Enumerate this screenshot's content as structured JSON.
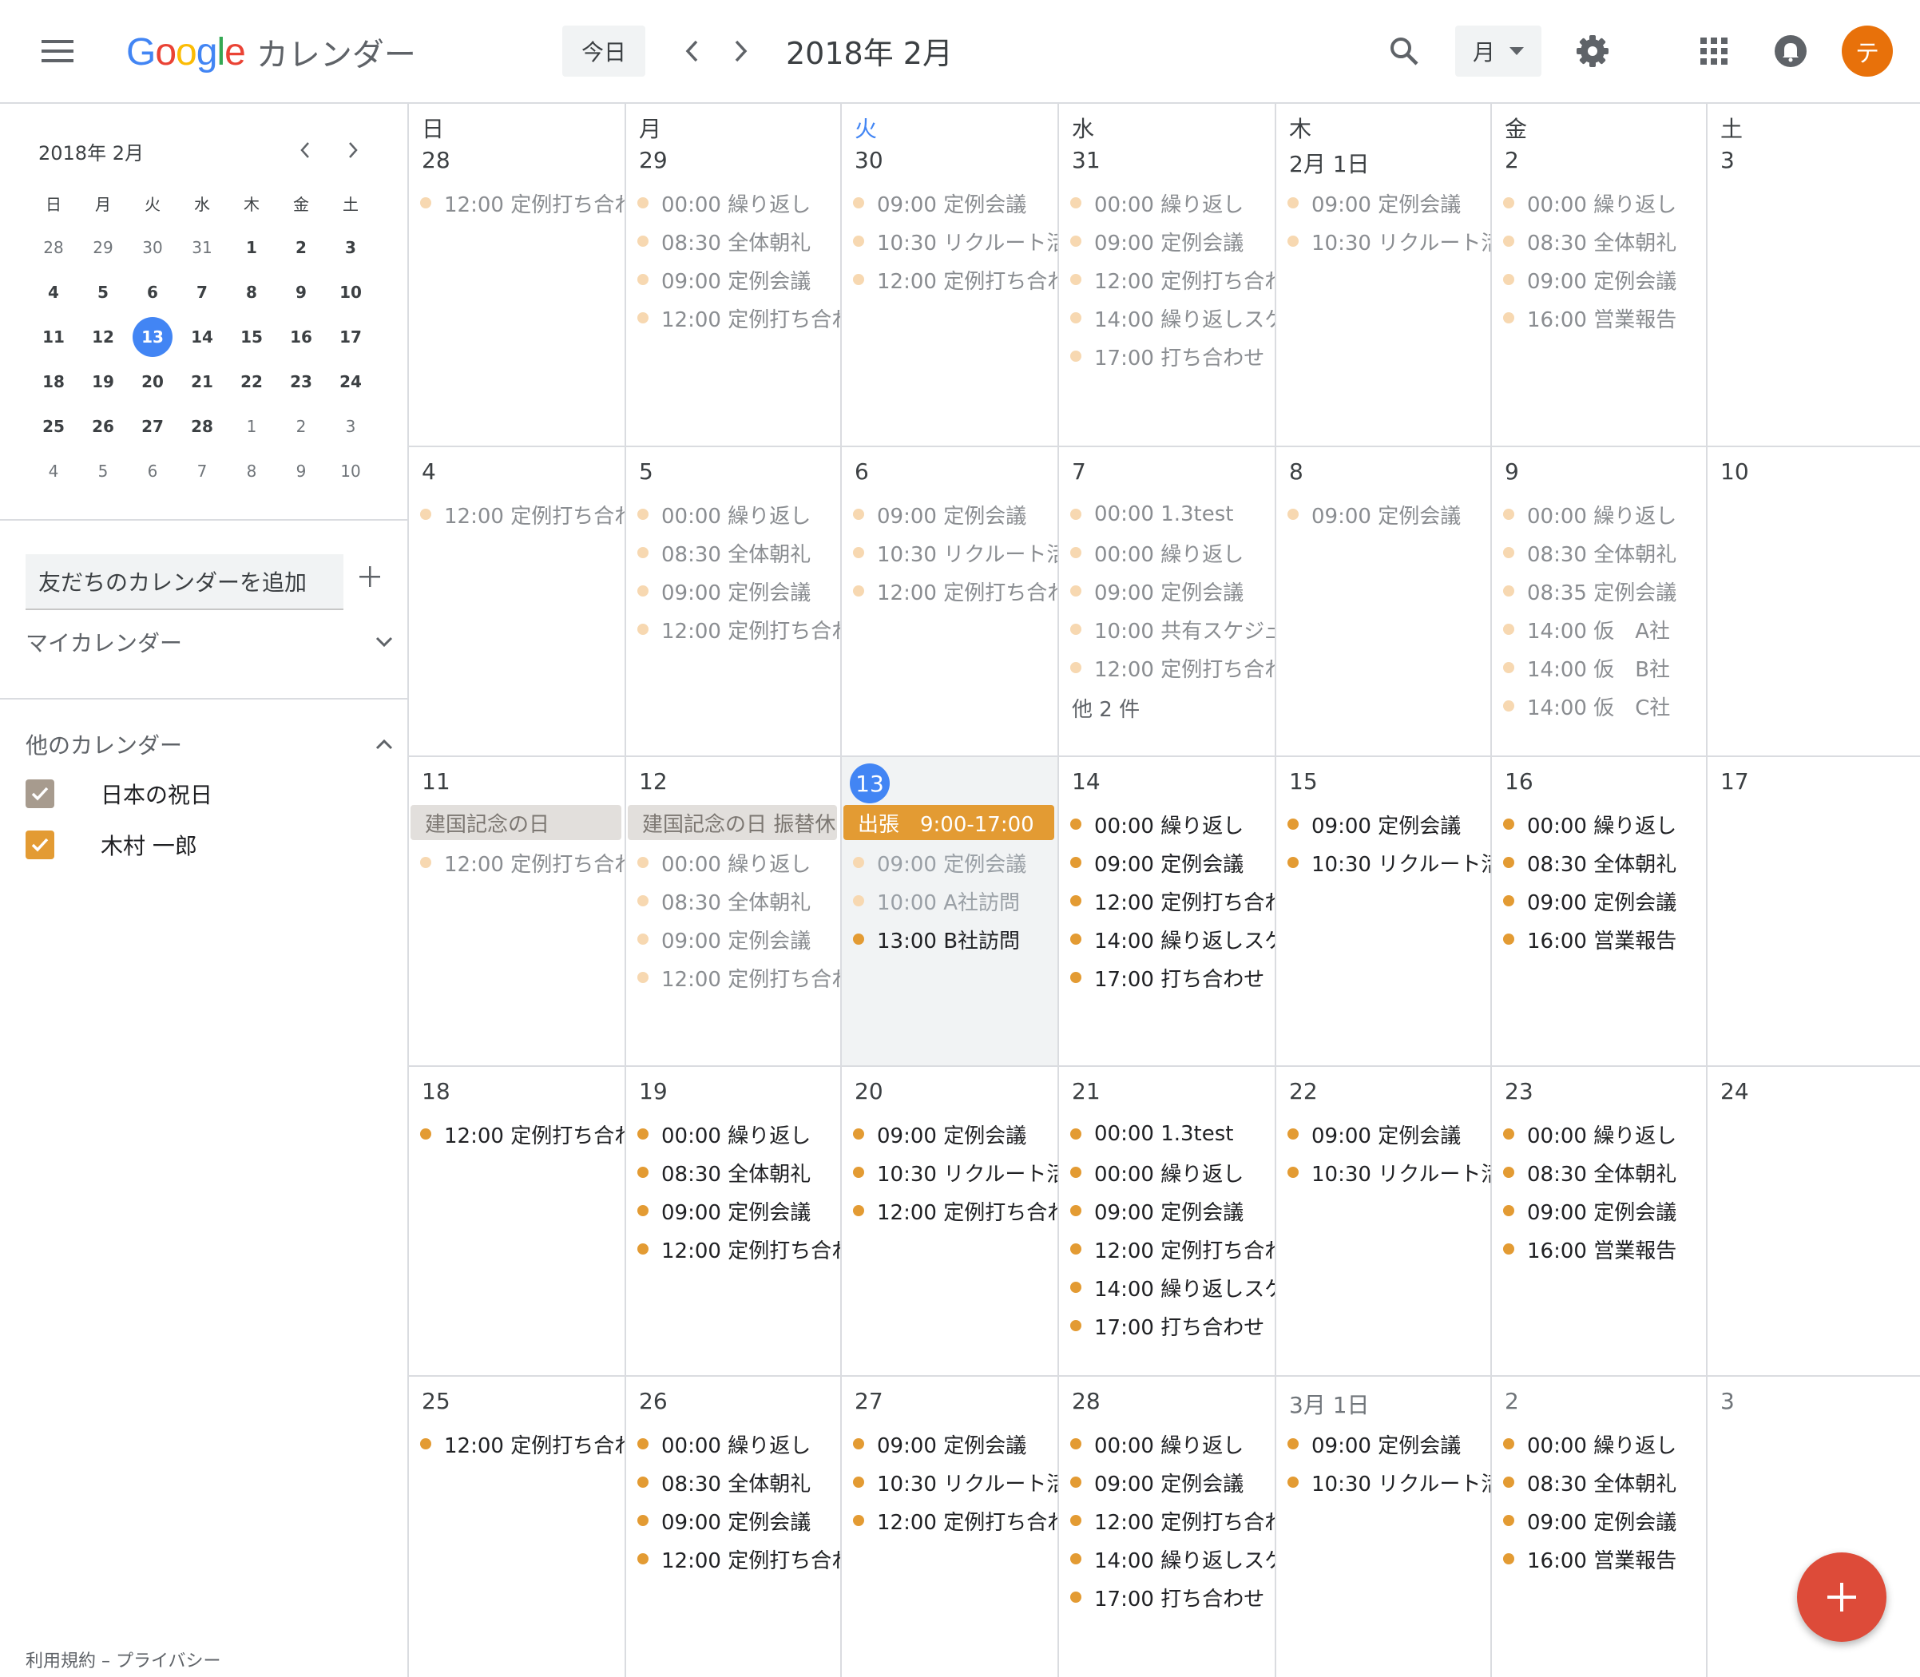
{
  "header": {
    "logo_text": "Google",
    "app_name": "カレンダー",
    "today_label": "今日",
    "current_period": "2018年 2月",
    "view_label": "月",
    "avatar_initial": "テ"
  },
  "mini_calendar": {
    "title": "2018年 2月",
    "weekday_headers": [
      "日",
      "月",
      "火",
      "水",
      "木",
      "金",
      "土"
    ],
    "weeks": [
      [
        "28",
        "29",
        "30",
        "31",
        "1",
        "2",
        "3"
      ],
      [
        "4",
        "5",
        "6",
        "7",
        "8",
        "9",
        "10"
      ],
      [
        "11",
        "12",
        "13",
        "14",
        "15",
        "16",
        "17"
      ],
      [
        "18",
        "19",
        "20",
        "21",
        "22",
        "23",
        "24"
      ],
      [
        "25",
        "26",
        "27",
        "28",
        "1",
        "2",
        "3"
      ],
      [
        "4",
        "5",
        "6",
        "7",
        "8",
        "9",
        "10"
      ]
    ],
    "today": "13"
  },
  "sidebar": {
    "add_friend_placeholder": "友だちのカレンダーを追加",
    "my_calendars_label": "マイカレンダー",
    "other_calendars_label": "他のカレンダー",
    "other_calendars": [
      {
        "name": "日本の祝日",
        "color": "#a79b8e",
        "checked": true
      },
      {
        "name": "木村 一郎",
        "color": "#e39b33",
        "checked": true
      }
    ],
    "footer": "利用規約 – プライバシー"
  },
  "colors": {
    "accent_blue": "#4285f4",
    "event_orange": "#e39b33",
    "event_past_dot": "#f7d8b1",
    "holiday_chip": "#e2dfdc",
    "fab_red": "#dd4b39",
    "avatar_orange": "#e8710a"
  },
  "month": {
    "weekday_headers": [
      "日",
      "月",
      "火",
      "水",
      "木",
      "金",
      "土"
    ],
    "weeks": [
      [
        {
          "date": "28",
          "events": [
            {
              "text": "12:00 定例打ち合わ",
              "state": "past"
            }
          ]
        },
        {
          "date": "29",
          "events": [
            {
              "text": "00:00 繰り返し",
              "state": "past"
            },
            {
              "text": "08:30 全体朝礼",
              "state": "past"
            },
            {
              "text": "09:00 定例会議",
              "state": "past"
            },
            {
              "text": "12:00 定例打ち合わ",
              "state": "past"
            }
          ]
        },
        {
          "date": "30",
          "events": [
            {
              "text": "09:00 定例会議",
              "state": "past"
            },
            {
              "text": "10:30 リクルート活",
              "state": "past"
            },
            {
              "text": "12:00 定例打ち合わ",
              "state": "past"
            }
          ]
        },
        {
          "date": "31",
          "events": [
            {
              "text": "00:00 繰り返し",
              "state": "past"
            },
            {
              "text": "09:00 定例会議",
              "state": "past"
            },
            {
              "text": "12:00 定例打ち合わ",
              "state": "past"
            },
            {
              "text": "14:00 繰り返しスケ",
              "state": "past"
            },
            {
              "text": "17:00 打ち合わせ",
              "state": "past"
            }
          ]
        },
        {
          "date": "2月 1日",
          "events": [
            {
              "text": "09:00 定例会議",
              "state": "past"
            },
            {
              "text": "10:30 リクルート活",
              "state": "past"
            }
          ]
        },
        {
          "date": "2",
          "events": [
            {
              "text": "00:00 繰り返し",
              "state": "past"
            },
            {
              "text": "08:30 全体朝礼",
              "state": "past"
            },
            {
              "text": "09:00 定例会議",
              "state": "past"
            },
            {
              "text": "16:00 営業報告",
              "state": "past"
            }
          ]
        },
        {
          "date": "3",
          "events": []
        }
      ],
      [
        {
          "date": "4",
          "events": [
            {
              "text": "12:00 定例打ち合わ",
              "state": "past"
            }
          ]
        },
        {
          "date": "5",
          "events": [
            {
              "text": "00:00 繰り返し",
              "state": "past"
            },
            {
              "text": "08:30 全体朝礼",
              "state": "past"
            },
            {
              "text": "09:00 定例会議",
              "state": "past"
            },
            {
              "text": "12:00 定例打ち合わ",
              "state": "past"
            }
          ]
        },
        {
          "date": "6",
          "events": [
            {
              "text": "09:00 定例会議",
              "state": "past"
            },
            {
              "text": "10:30 リクルート活",
              "state": "past"
            },
            {
              "text": "12:00 定例打ち合わ",
              "state": "past"
            }
          ]
        },
        {
          "date": "7",
          "events": [
            {
              "text": "00:00 1.3test",
              "state": "past"
            },
            {
              "text": "00:00 繰り返し",
              "state": "past"
            },
            {
              "text": "09:00 定例会議",
              "state": "past"
            },
            {
              "text": "10:00 共有スケジュ",
              "state": "past"
            },
            {
              "text": "12:00 定例打ち合わ",
              "state": "past"
            }
          ],
          "more": "他 2 件"
        },
        {
          "date": "8",
          "events": [
            {
              "text": "09:00 定例会議",
              "state": "past"
            }
          ]
        },
        {
          "date": "9",
          "events": [
            {
              "text": "00:00 繰り返し",
              "state": "past"
            },
            {
              "text": "08:30 全体朝礼",
              "state": "past"
            },
            {
              "text": "08:35 定例会議",
              "state": "past"
            },
            {
              "text": "14:00 仮　A社",
              "state": "past"
            },
            {
              "text": "14:00 仮　B社",
              "state": "past"
            },
            {
              "text": "14:00 仮　C社",
              "state": "past"
            }
          ]
        },
        {
          "date": "10",
          "events": []
        }
      ],
      [
        {
          "date": "11",
          "chip": {
            "text": "建国記念の日",
            "kind": "holiday"
          },
          "events": [
            {
              "text": "12:00 定例打ち合わ",
              "state": "past"
            }
          ]
        },
        {
          "date": "12",
          "chip": {
            "text": "建国記念の日 振替休",
            "kind": "holiday"
          },
          "events": [
            {
              "text": "00:00 繰り返し",
              "state": "past"
            },
            {
              "text": "08:30 全体朝礼",
              "state": "past"
            },
            {
              "text": "09:00 定例会議",
              "state": "past"
            },
            {
              "text": "12:00 定例打ち合わ",
              "state": "past"
            }
          ]
        },
        {
          "date": "13",
          "today": true,
          "chip": {
            "text": "出張　9:00-17:00",
            "kind": "trip"
          },
          "events": [
            {
              "text": "09:00 定例会議",
              "state": "dim"
            },
            {
              "text": "10:00 A社訪問",
              "state": "dim"
            },
            {
              "text": "13:00 B社訪問",
              "state": "cur"
            }
          ]
        },
        {
          "date": "14",
          "events": [
            {
              "text": "00:00 繰り返し",
              "state": "cur"
            },
            {
              "text": "09:00 定例会議",
              "state": "cur"
            },
            {
              "text": "12:00 定例打ち合わ",
              "state": "cur"
            },
            {
              "text": "14:00 繰り返しスケ",
              "state": "cur"
            },
            {
              "text": "17:00 打ち合わせ",
              "state": "cur"
            }
          ]
        },
        {
          "date": "15",
          "events": [
            {
              "text": "09:00 定例会議",
              "state": "cur"
            },
            {
              "text": "10:30 リクルート活",
              "state": "cur"
            }
          ]
        },
        {
          "date": "16",
          "events": [
            {
              "text": "00:00 繰り返し",
              "state": "cur"
            },
            {
              "text": "08:30 全体朝礼",
              "state": "cur"
            },
            {
              "text": "09:00 定例会議",
              "state": "cur"
            },
            {
              "text": "16:00 営業報告",
              "state": "cur"
            }
          ]
        },
        {
          "date": "17",
          "events": []
        }
      ],
      [
        {
          "date": "18",
          "events": [
            {
              "text": "12:00 定例打ち合わ",
              "state": "cur"
            }
          ]
        },
        {
          "date": "19",
          "events": [
            {
              "text": "00:00 繰り返し",
              "state": "cur"
            },
            {
              "text": "08:30 全体朝礼",
              "state": "cur"
            },
            {
              "text": "09:00 定例会議",
              "state": "cur"
            },
            {
              "text": "12:00 定例打ち合わ",
              "state": "cur"
            }
          ]
        },
        {
          "date": "20",
          "events": [
            {
              "text": "09:00 定例会議",
              "state": "cur"
            },
            {
              "text": "10:30 リクルート活",
              "state": "cur"
            },
            {
              "text": "12:00 定例打ち合わ",
              "state": "cur"
            }
          ]
        },
        {
          "date": "21",
          "events": [
            {
              "text": "00:00 1.3test",
              "state": "cur"
            },
            {
              "text": "00:00 繰り返し",
              "state": "cur"
            },
            {
              "text": "09:00 定例会議",
              "state": "cur"
            },
            {
              "text": "12:00 定例打ち合わ",
              "state": "cur"
            },
            {
              "text": "14:00 繰り返しスケ",
              "state": "cur"
            },
            {
              "text": "17:00 打ち合わせ",
              "state": "cur"
            }
          ]
        },
        {
          "date": "22",
          "events": [
            {
              "text": "09:00 定例会議",
              "state": "cur"
            },
            {
              "text": "10:30 リクルート活",
              "state": "cur"
            }
          ]
        },
        {
          "date": "23",
          "events": [
            {
              "text": "00:00 繰り返し",
              "state": "cur"
            },
            {
              "text": "08:30 全体朝礼",
              "state": "cur"
            },
            {
              "text": "09:00 定例会議",
              "state": "cur"
            },
            {
              "text": "16:00 営業報告",
              "state": "cur"
            }
          ]
        },
        {
          "date": "24",
          "events": []
        }
      ],
      [
        {
          "date": "25",
          "events": [
            {
              "text": "12:00 定例打ち合わ",
              "state": "cur"
            }
          ]
        },
        {
          "date": "26",
          "events": [
            {
              "text": "00:00 繰り返し",
              "state": "cur"
            },
            {
              "text": "08:30 全体朝礼",
              "state": "cur"
            },
            {
              "text": "09:00 定例会議",
              "state": "cur"
            },
            {
              "text": "12:00 定例打ち合わ",
              "state": "cur"
            }
          ]
        },
        {
          "date": "27",
          "events": [
            {
              "text": "09:00 定例会議",
              "state": "cur"
            },
            {
              "text": "10:30 リクルート活",
              "state": "cur"
            },
            {
              "text": "12:00 定例打ち合わ",
              "state": "cur"
            }
          ]
        },
        {
          "date": "28",
          "events": [
            {
              "text": "00:00 繰り返し",
              "state": "cur"
            },
            {
              "text": "09:00 定例会議",
              "state": "cur"
            },
            {
              "text": "12:00 定例打ち合わ",
              "state": "cur"
            },
            {
              "text": "14:00 繰り返しスケ",
              "state": "cur"
            },
            {
              "text": "17:00 打ち合わせ",
              "state": "cur"
            }
          ]
        },
        {
          "date": "3月 1日",
          "other": true,
          "events": [
            {
              "text": "09:00 定例会議",
              "state": "cur"
            },
            {
              "text": "10:30 リクルート活",
              "state": "cur"
            }
          ]
        },
        {
          "date": "2",
          "other": true,
          "events": [
            {
              "text": "00:00 繰り返し",
              "state": "cur"
            },
            {
              "text": "08:30 全体朝礼",
              "state": "cur"
            },
            {
              "text": "09:00 定例会議",
              "state": "cur"
            },
            {
              "text": "16:00 営業報告",
              "state": "cur"
            }
          ]
        },
        {
          "date": "3",
          "other": true,
          "events": []
        }
      ]
    ]
  }
}
